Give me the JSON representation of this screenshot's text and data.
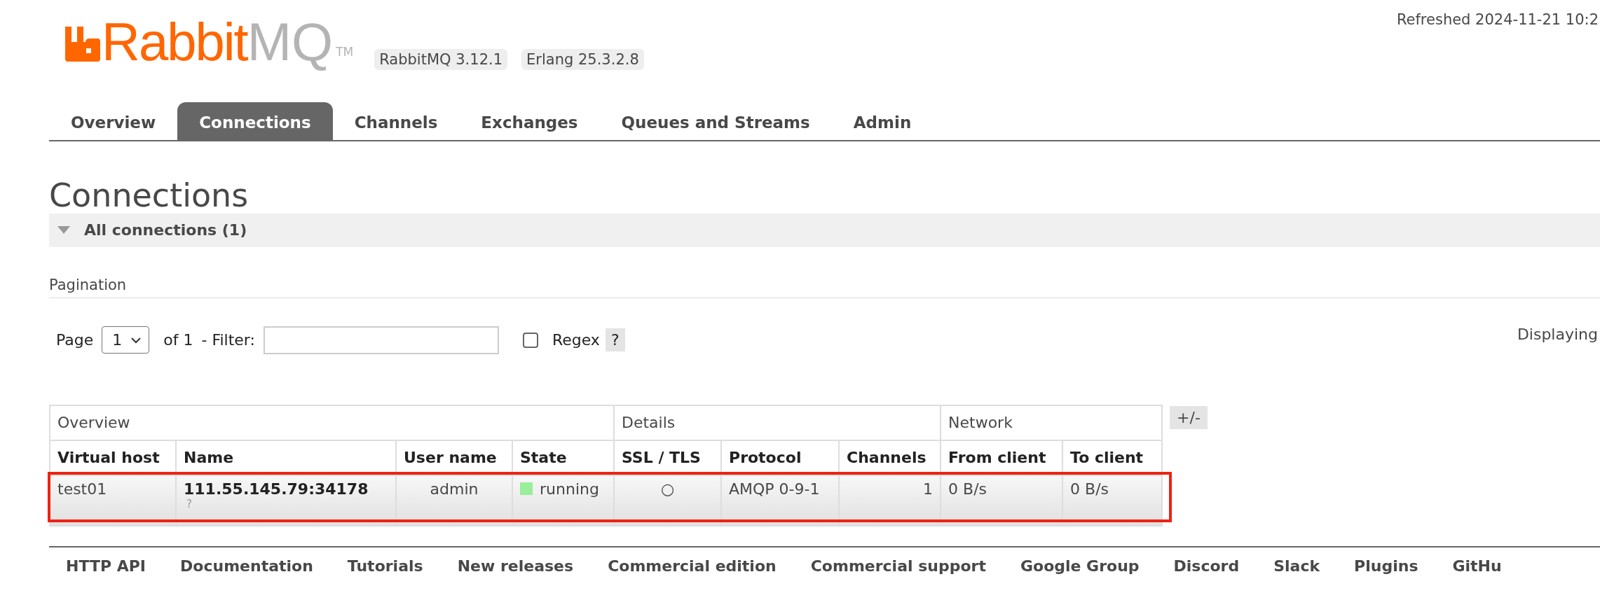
{
  "header": {
    "logo": {
      "brand": "Rabbit",
      "suffix": "MQ",
      "trademark": "TM"
    },
    "versions": [
      "RabbitMQ 3.12.1",
      "Erlang 25.3.2.8"
    ],
    "refreshed": "Refreshed 2024-11-21 10:2"
  },
  "tabs": [
    {
      "label": "Overview",
      "selected": false
    },
    {
      "label": "Connections",
      "selected": true
    },
    {
      "label": "Channels",
      "selected": false
    },
    {
      "label": "Exchanges",
      "selected": false
    },
    {
      "label": "Queues and Streams",
      "selected": false
    },
    {
      "label": "Admin",
      "selected": false
    }
  ],
  "page_title": "Connections",
  "section": {
    "title": "All connections (1)",
    "expanded": true
  },
  "pagination": {
    "heading": "Pagination",
    "page_label": "Page",
    "page": "1",
    "of": "of 1",
    "filter_label": "- Filter:",
    "regex": {
      "label": "Regex",
      "checked": false
    },
    "help": "?",
    "displaying": "Displaying"
  },
  "table": {
    "groups": [
      {
        "label": "Overview"
      },
      {
        "label": "Details"
      },
      {
        "label": "Network"
      }
    ],
    "columns": [
      "Virtual host",
      "Name",
      "User name",
      "State",
      "SSL / TLS",
      "Protocol",
      "Channels",
      "From client",
      "To client"
    ],
    "toggle": "+/-",
    "rows": [
      {
        "virtual_host": "test01",
        "name": "111.55.145.79:34178",
        "name_hint": "?",
        "user": "admin",
        "state": {
          "label": "running",
          "color": "#99ee99"
        },
        "ssl": "○",
        "protocol": "AMQP 0-9-1",
        "channels": "1",
        "from_client": "0 B/s",
        "to_client": "0 B/s",
        "highlighted": true
      }
    ]
  },
  "footer": [
    "HTTP API",
    "Documentation",
    "Tutorials",
    "New releases",
    "Commercial edition",
    "Commercial support",
    "Google Group",
    "Discord",
    "Slack",
    "Plugins",
    "GitHu"
  ]
}
